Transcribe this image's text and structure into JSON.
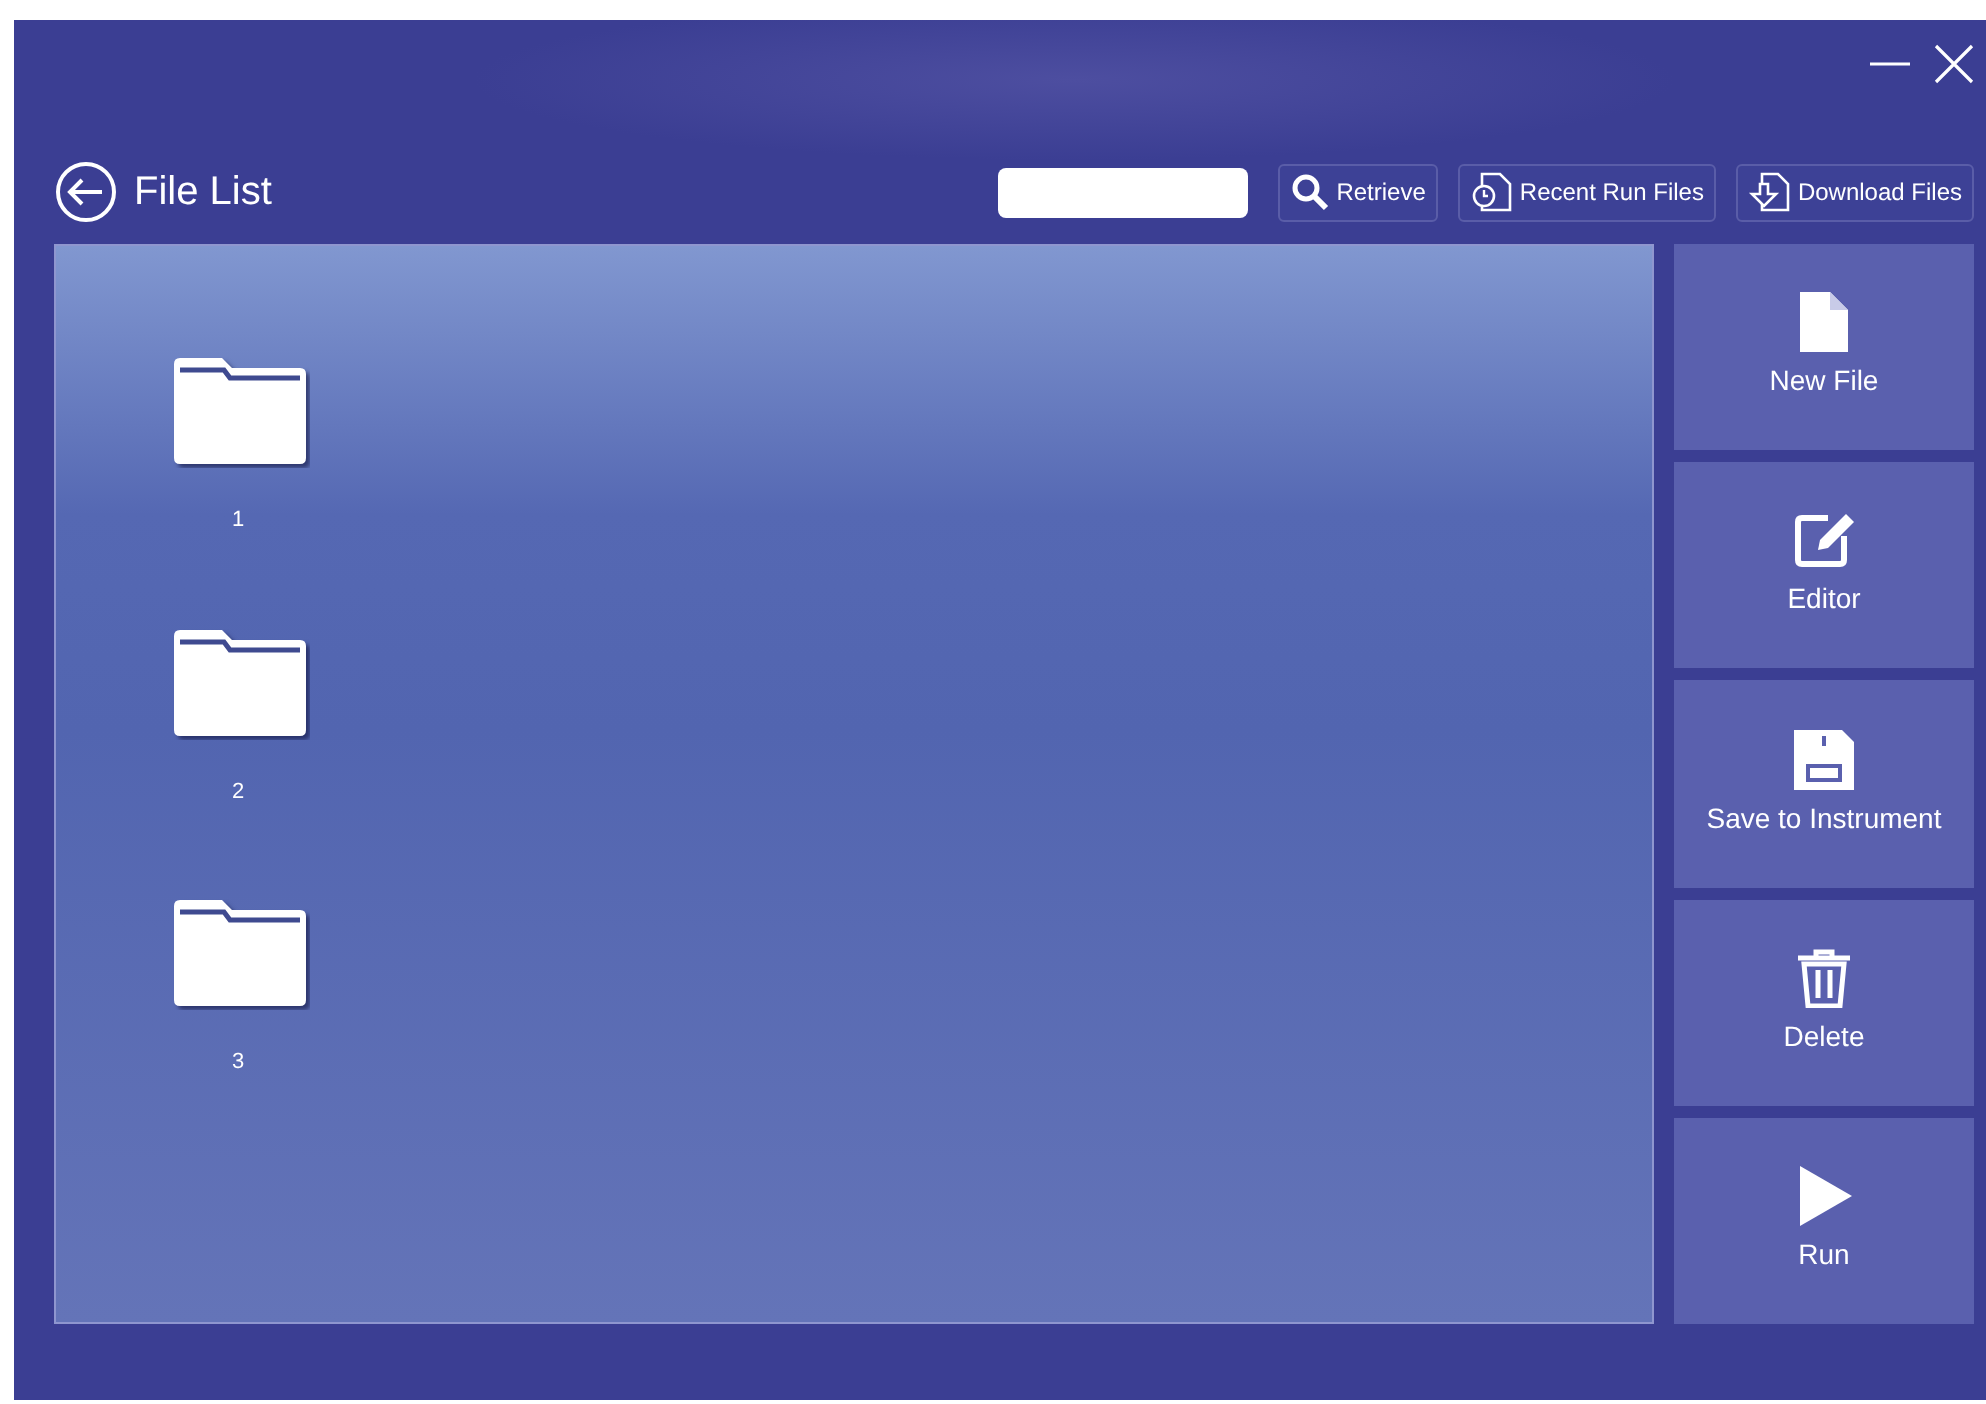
{
  "window": {
    "controls": [
      {
        "kind": "minimize"
      },
      {
        "kind": "close"
      }
    ]
  },
  "header": {
    "title": "File List"
  },
  "toolbar": [
    {
      "kind": "search",
      "label": "Retrieve"
    },
    {
      "kind": "recent",
      "label": "Recent Run Files"
    },
    {
      "kind": "download",
      "label": "Download Files"
    }
  ],
  "folders": [
    {
      "label": "1"
    },
    {
      "label": "2"
    },
    {
      "label": "3"
    }
  ],
  "actions": [
    {
      "kind": "new",
      "label": "New File"
    },
    {
      "kind": "edit",
      "label": "Editor"
    },
    {
      "kind": "save",
      "label": "Save to Instrument"
    },
    {
      "kind": "delete",
      "label": "Delete"
    },
    {
      "kind": "run",
      "label": "Run"
    }
  ]
}
